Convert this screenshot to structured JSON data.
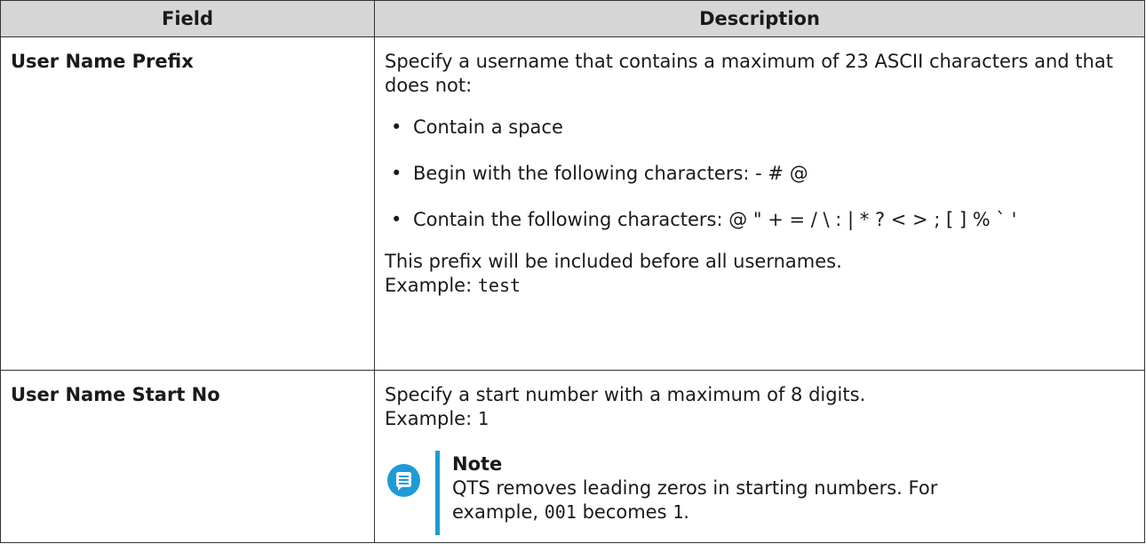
{
  "table": {
    "headers": [
      "Field",
      "Description"
    ],
    "rows": [
      {
        "field": "User Name Prefix",
        "intro": "Specify a username that contains a maximum of 23 ASCII characters and that does not:",
        "bullets": [
          "Contain a space",
          "Begin with the following characters: - # @",
          "Contain the following characters: @ \" + = / \\ : | * ? < > ; [ ] % ` '"
        ],
        "after": "This prefix will be included before all usernames.",
        "example_label": "Example:",
        "example_value": "test"
      },
      {
        "field": "User Name Start No",
        "intro": "Specify a start number with a maximum of 8 digits.",
        "example_label": "Example:",
        "example_value": "1",
        "note": {
          "title": "Note",
          "text_before": "QTS removes leading zeros in starting numbers. For example,",
          "code_from": "001",
          "text_mid": "becomes",
          "code_to": "1",
          "text_end": ".",
          "icon": "note-icon",
          "accent_color": "#1e9bd7"
        }
      }
    ]
  }
}
